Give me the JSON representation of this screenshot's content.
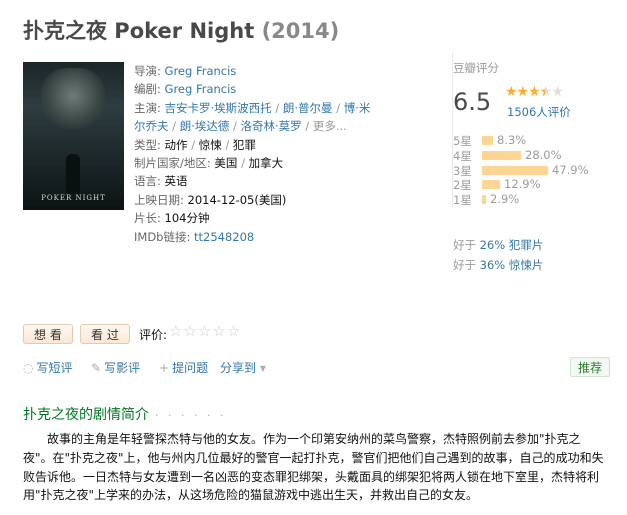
{
  "title": {
    "name": "扑克之夜 Poker Night",
    "year": "(2014)"
  },
  "poster": {
    "text": "POKER NIGHT"
  },
  "info": {
    "director_label": "导演:",
    "director": "Greg Francis",
    "writer_label": "编剧:",
    "writer": "Greg Francis",
    "cast_label": "主演:",
    "cast": [
      "吉安卡罗·埃斯波西托",
      "朗·普尔曼",
      "博·米",
      "尔乔夫",
      "朗·埃达德",
      "洛奇林·莫罗"
    ],
    "more": "更多...",
    "genre_label": "类型:",
    "genres": [
      "动作",
      "惊悚",
      "犯罪"
    ],
    "country_label": "制片国家/地区:",
    "countries": [
      "美国",
      "加拿大"
    ],
    "language_label": "语言:",
    "language": "英语",
    "release_label": "上映日期:",
    "release": "2014-12-05(美国)",
    "runtime_label": "片长:",
    "runtime": "104分钟",
    "imdb_label": "IMDb链接:",
    "imdb": "tt2548208"
  },
  "rating": {
    "header": "豆瓣评分",
    "score": "6.5",
    "stars_value": 3.5,
    "votes": "1506人评价",
    "distribution": [
      {
        "label": "5星",
        "pct": "8.3%",
        "value": 8.3
      },
      {
        "label": "4星",
        "pct": "28.0%",
        "value": 28.0
      },
      {
        "label": "3星",
        "pct": "47.9%",
        "value": 47.9
      },
      {
        "label": "2星",
        "pct": "12.9%",
        "value": 12.9
      },
      {
        "label": "1星",
        "pct": "2.9%",
        "value": 2.9
      }
    ],
    "better_than": [
      {
        "prefix": "好于 ",
        "value": "26% 犯罪片"
      },
      {
        "prefix": "好于 ",
        "value": "36% 惊悚片"
      }
    ]
  },
  "buttons": {
    "want": "想 看",
    "seen": "看 过",
    "rate_label": "评价:"
  },
  "actions": {
    "short_review": "写短评",
    "review": "写影评",
    "ask": "提问题",
    "share": "分享到",
    "recommend": "推荐"
  },
  "summary": {
    "heading": "扑克之夜的剧情简介",
    "dots": "· · · · · ·",
    "text": "故事的主角是年轻警探杰特与他的女友。作为一个印第安纳州的菜鸟警察，杰特照例前去参加\"扑克之夜\"。在\"扑克之夜\"上，他与州内几位最好的警官一起打扑克，警官们把他们自己遇到的故事，自己的成功和失败告诉他。一日杰特与女友遭到一名凶恶的变态罪犯绑架，头戴面具的绑架犯将两人锁在地下室里，杰特将利用\"扑克之夜\"上学来的办法，从这场危险的猫鼠游戏中逃出生天，并救出自己的女友。"
  }
}
